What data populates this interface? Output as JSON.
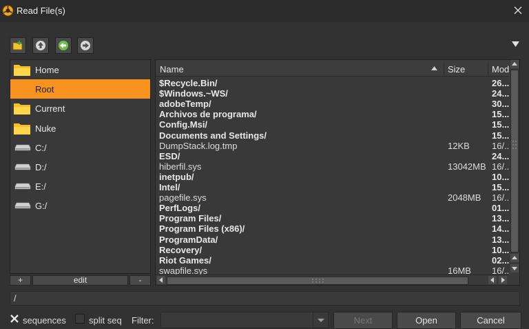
{
  "window": {
    "title": "Read File(s)"
  },
  "sidebar": {
    "items": [
      {
        "label": "Home",
        "icon": "folder-icon"
      },
      {
        "label": "Root",
        "icon": "folder-icon",
        "selected": true
      },
      {
        "label": "Current",
        "icon": "folder-icon"
      },
      {
        "label": "Nuke",
        "icon": "folder-icon"
      },
      {
        "label": "C:/",
        "icon": "drive-icon"
      },
      {
        "label": "D:/",
        "icon": "drive-icon"
      },
      {
        "label": "E:/",
        "icon": "drive-icon"
      },
      {
        "label": "G:/",
        "icon": "drive-icon"
      }
    ],
    "add_label": "+",
    "edit_label": "edit",
    "remove_label": "-"
  },
  "filelist": {
    "columns": {
      "name": "Name",
      "size": "Size",
      "modified": "Modi"
    },
    "rows": [
      {
        "name": "$Recycle.Bin/",
        "size": "",
        "modified": "26...",
        "dir": true
      },
      {
        "name": "$Windows.~WS/",
        "size": "",
        "modified": "24...",
        "dir": true
      },
      {
        "name": "adobeTemp/",
        "size": "",
        "modified": "30...",
        "dir": true
      },
      {
        "name": "Archivos de programa/",
        "size": "",
        "modified": "15...",
        "dir": true
      },
      {
        "name": "Config.Msi/",
        "size": "",
        "modified": "15...",
        "dir": true
      },
      {
        "name": "Documents and Settings/",
        "size": "",
        "modified": "15...",
        "dir": true
      },
      {
        "name": "DumpStack.log.tmp",
        "size": "12KB",
        "modified": "16/...",
        "dir": false
      },
      {
        "name": "ESD/",
        "size": "",
        "modified": "24...",
        "dir": true
      },
      {
        "name": "hiberfil.sys",
        "size": "13042MB",
        "modified": "16/...",
        "dir": false
      },
      {
        "name": "inetpub/",
        "size": "",
        "modified": "10...",
        "dir": true
      },
      {
        "name": "Intel/",
        "size": "",
        "modified": "15...",
        "dir": true
      },
      {
        "name": "pagefile.sys",
        "size": "2048MB",
        "modified": "16/...",
        "dir": false
      },
      {
        "name": "PerfLogs/",
        "size": "",
        "modified": "01...",
        "dir": true
      },
      {
        "name": "Program Files/",
        "size": "",
        "modified": "13...",
        "dir": true
      },
      {
        "name": "Program Files (x86)/",
        "size": "",
        "modified": "14...",
        "dir": true
      },
      {
        "name": "ProgramData/",
        "size": "",
        "modified": "13...",
        "dir": true
      },
      {
        "name": "Recovery/",
        "size": "",
        "modified": "10...",
        "dir": true
      },
      {
        "name": "Riot Games/",
        "size": "",
        "modified": "02...",
        "dir": true
      },
      {
        "name": "swapfile.sys",
        "size": "16MB",
        "modified": "16/...",
        "dir": false
      }
    ]
  },
  "path": {
    "value": "/"
  },
  "bottom": {
    "sequences_label": "sequences",
    "sequences_checked": true,
    "split_seq_label": "split seq",
    "split_seq_checked": false,
    "filter_label": "Filter:",
    "filter_value": "",
    "next_label": "Next",
    "open_label": "Open",
    "cancel_label": "Cancel"
  },
  "colors": {
    "accent": "#f7931e",
    "background": "#323232",
    "panel": "#393939"
  }
}
